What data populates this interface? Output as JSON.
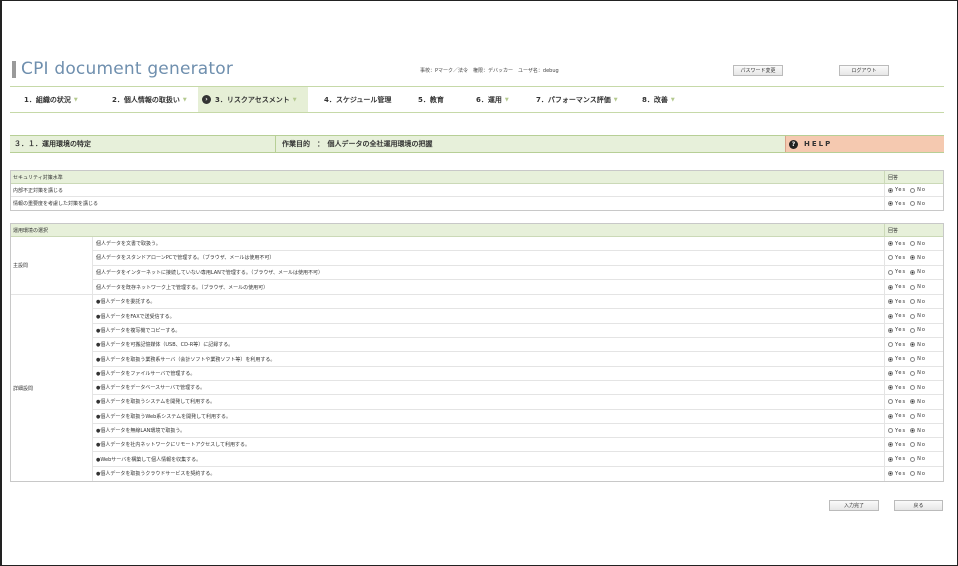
{
  "app": {
    "title": "CPI document generator",
    "user_info": "事校：Pマーク／法令　権限：デバッカー　ユーザ名：debug",
    "btn_password": "パスワード変更",
    "btn_logout": "ログアウト"
  },
  "nav": [
    {
      "label": "1．組織の状況",
      "arrow": "▼",
      "active": false
    },
    {
      "label": "2．個人情報の取扱い",
      "arrow": "▼",
      "active": false
    },
    {
      "label": "3．リスクアセスメント",
      "arrow": "▼",
      "active": true
    },
    {
      "label": "4．スケジュール管理",
      "arrow": "",
      "active": false
    },
    {
      "label": "5．教育",
      "arrow": "",
      "active": false
    },
    {
      "label": "6．運用",
      "arrow": "▼",
      "active": false
    },
    {
      "label": "7．パフォーマンス評価",
      "arrow": "▼",
      "active": false
    },
    {
      "label": "8．改善",
      "arrow": "▼",
      "active": false
    }
  ],
  "title_strip": {
    "section": "３．１．運用環境の特定",
    "purpose": "作業目的　：　個人データの全社運用環境の把握",
    "help": "HELP"
  },
  "security": {
    "header": "セキュリティ対策水準",
    "answer_header": "回答",
    "rows": [
      {
        "text": "内部不正対策を講じる",
        "yes": true
      },
      {
        "text": "情報の重要度を考慮した対策を講じる",
        "yes": true
      }
    ]
  },
  "radio": {
    "yes": "Yes",
    "no": "No"
  },
  "environment": {
    "header": "運用環境の選択",
    "answer_header": "回答",
    "groups": [
      {
        "label": "主設問",
        "rows": [
          {
            "text": "個人データを文書で取扱う。",
            "yes": true
          },
          {
            "text": "個人データをスタンドアローンPCで管理する。（ブラウザ、メールは使用不可）",
            "yes": false
          },
          {
            "text": "個人データをインターネットに接続していない専用LANで管理する。（ブラウザ、メールは使用不可）",
            "yes": false
          },
          {
            "text": "個人データを既存ネットワーク上で管理する。（ブラウザ、メールの使用可）",
            "yes": true
          }
        ]
      },
      {
        "label": "詳細設問",
        "rows": [
          {
            "text": "●個人データを委託する。",
            "yes": true
          },
          {
            "text": "●個人データをFAXで送受信する。",
            "yes": true
          },
          {
            "text": "●個人データを複写機でコピーする。",
            "yes": true
          },
          {
            "text": "●個人データを可搬記憶媒体（USB、CD-R等）に記録する。",
            "yes": false
          },
          {
            "text": "●個人データを取扱う業務系サーバ（会計ソフトや業務ソフト等）を利用する。",
            "yes": true
          },
          {
            "text": "●個人データをファイルサーバで管理する。",
            "yes": true
          },
          {
            "text": "●個人データをデータベースサーバで管理する。",
            "yes": true
          },
          {
            "text": "●個人データを取扱うシステムを開発して利用する。",
            "yes": false
          },
          {
            "text": "●個人データを取扱うWeb系システムを開発して利用する。",
            "yes": true
          },
          {
            "text": "●個人データを無線LAN環境で取扱う。",
            "yes": false
          },
          {
            "text": "●個人データを社内ネットワークにリモートアクセスして利用する。",
            "yes": true
          },
          {
            "text": "●Webサーバを構築して個人情報を収集する。",
            "yes": true
          },
          {
            "text": "●個人データを取扱うクラウドサービスを契約する。",
            "yes": true
          }
        ]
      }
    ]
  },
  "footer": {
    "btn_complete": "入力完了",
    "btn_back": "戻る"
  }
}
